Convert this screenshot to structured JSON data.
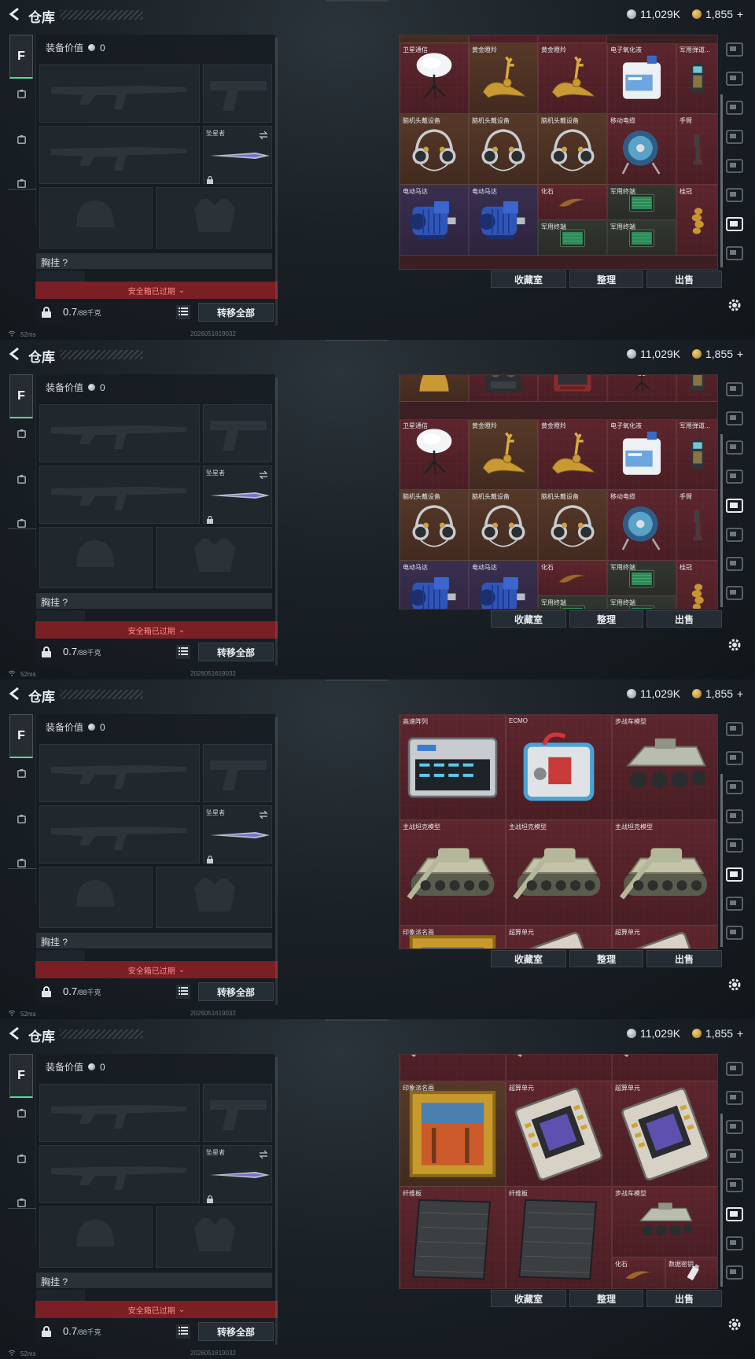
{
  "header": {
    "title": "仓库",
    "silver": "11,029K",
    "gold": "1,855",
    "plus": "+"
  },
  "left_tabs": {
    "active_label": "F"
  },
  "equipment": {
    "value_label": "装备价值",
    "value": "0",
    "knife_slot_label": "坠星者",
    "chest_label": "胸挂",
    "chest_value": "?",
    "safe_box_text": "安全箱已过期",
    "weight": "0.7",
    "weight_unit": "/88千克",
    "transfer_all": "转移全部"
  },
  "actions": {
    "collection": "收藏室",
    "sort": "整理",
    "sell": "出售"
  },
  "status": {
    "ping": "52ms",
    "timestamp": "2026051619032"
  },
  "panels": [
    {
      "cells": [
        {
          "label": "",
          "icon": "partial-top"
        },
        {
          "label": "",
          "icon": "partial-top"
        },
        {
          "label": "",
          "icon": "partial-top"
        },
        {
          "label": "卫星通信",
          "icon": "satellite-dish"
        },
        {
          "label": "黄金瞪羚",
          "icon": "gold-gazelle"
        },
        {
          "label": "黄金瞪羚",
          "icon": "gold-gazelle"
        },
        {
          "label": "电子氧化液",
          "icon": "chemical-jug"
        },
        {
          "label": "军用弹道...",
          "icon": "ballistic-computer"
        },
        {
          "label": "脑机头戴设备",
          "icon": "headset"
        },
        {
          "label": "脑机头戴设备",
          "icon": "headset"
        },
        {
          "label": "脑机头戴设备",
          "icon": "headset"
        },
        {
          "label": "移动电缆",
          "icon": "cable-reel"
        },
        {
          "label": "手臂",
          "icon": "robot-arm"
        },
        {
          "label": "电动马达",
          "icon": "electric-motor"
        },
        {
          "label": "电动马达",
          "icon": "electric-motor"
        },
        {
          "label": "化石",
          "icon": "fossil-claw"
        },
        {
          "label": "军用终端",
          "icon": "military-tablet"
        },
        {
          "label": "桂冠",
          "icon": "laurel-crown"
        },
        {
          "label": "军用终端",
          "icon": "military-tablet"
        },
        {
          "label": "军用终端",
          "icon": "military-tablet"
        }
      ]
    },
    {
      "cells": [
        {
          "label": "",
          "icon": "gold-statue"
        },
        {
          "label": "",
          "icon": "tape-recorder"
        },
        {
          "label": "",
          "icon": "old-monitor"
        },
        {
          "label": "",
          "icon": "satellite-dish"
        },
        {
          "label": "",
          "icon": "ballistic-computer"
        },
        {
          "label": "卫星通信",
          "icon": "satellite-dish"
        },
        {
          "label": "黄金瞪羚",
          "icon": "gold-gazelle"
        },
        {
          "label": "黄金瞪羚",
          "icon": "gold-gazelle"
        },
        {
          "label": "电子氧化液",
          "icon": "chemical-jug"
        },
        {
          "label": "军用弹道...",
          "icon": "ballistic-computer"
        },
        {
          "label": "脑机头戴设备",
          "icon": "headset"
        },
        {
          "label": "脑机头戴设备",
          "icon": "headset"
        },
        {
          "label": "脑机头戴设备",
          "icon": "headset"
        },
        {
          "label": "移动电缆",
          "icon": "cable-reel"
        },
        {
          "label": "手臂",
          "icon": "robot-arm"
        },
        {
          "label": "电动马达",
          "icon": "electric-motor"
        },
        {
          "label": "电动马达",
          "icon": "electric-motor"
        },
        {
          "label": "化石",
          "icon": "fossil-claw"
        },
        {
          "label": "军用终端",
          "icon": "military-tablet"
        },
        {
          "label": "桂冠",
          "icon": "laurel-crown"
        },
        {
          "label": "军用终端",
          "icon": "military-tablet"
        },
        {
          "label": "军用终端",
          "icon": "military-tablet"
        }
      ]
    },
    {
      "cells": [
        {
          "label": "高速阵列",
          "icon": "server-array"
        },
        {
          "label": "ECMO",
          "icon": "ecmo-machine"
        },
        {
          "label": "步战车模型",
          "icon": "ifv-model"
        },
        {
          "label": "主战坦克模型",
          "icon": "tank-model"
        },
        {
          "label": "主战坦克模型",
          "icon": "tank-model"
        },
        {
          "label": "主战坦克模型",
          "icon": "tank-model"
        },
        {
          "label": "印象派名画",
          "icon": "painting"
        },
        {
          "label": "超算单元",
          "icon": "supercomputer-unit"
        },
        {
          "label": "超算单元",
          "icon": "supercomputer-unit"
        }
      ]
    },
    {
      "cells": [
        {
          "label": "",
          "icon": "tank-model"
        },
        {
          "label": "",
          "icon": "tank-model"
        },
        {
          "label": "",
          "icon": "tank-model"
        },
        {
          "label": "印象派名画",
          "icon": "painting"
        },
        {
          "label": "超算单元",
          "icon": "supercomputer-unit"
        },
        {
          "label": "超算单元",
          "icon": "supercomputer-unit"
        },
        {
          "label": "纤维板",
          "icon": "fiber-board"
        },
        {
          "label": "纤维板",
          "icon": "fiber-board"
        },
        {
          "label": "步战车模型",
          "icon": "ifv-model"
        },
        {
          "label": "化石",
          "icon": "fossil-claw"
        },
        {
          "label": "数据密钥",
          "icon": "usb-key"
        }
      ]
    }
  ]
}
